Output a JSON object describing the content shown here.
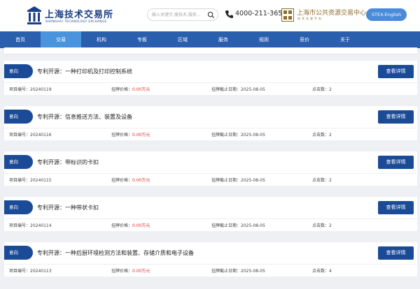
{
  "header": {
    "logo_text": "上海技术交易所",
    "logo_sub": "SHANGHAI TECHNOLOGY EXCHANGE",
    "search_placeholder": "输入关键字,搜技术,服务...",
    "phone": "4000-211-365",
    "center_name": "上海市公共资源交易中心",
    "center_sub": "技术交易平台",
    "lang_button": "STEX-English"
  },
  "nav": {
    "items": [
      "首页",
      "交易",
      "机构",
      "专板",
      "区域",
      "服务",
      "规则",
      "竞价",
      "关于"
    ],
    "active_index": 1
  },
  "cards": [
    {
      "tag": "意向",
      "title": "专利开源：一种打印机及打印控制系统",
      "button": "查看详情",
      "id_label": "项目编号：",
      "id": "20240119",
      "price_label": "挂牌价格：",
      "price": "0.00万元",
      "date_label": "挂牌截止日期：",
      "date": "2025-08-05",
      "clicks_label": "点击数：",
      "clicks": "2"
    },
    {
      "tag": "意向",
      "title": "专利开源：信息推送方法、装置及设备",
      "button": "查看详情",
      "id_label": "项目编号：",
      "id": "20240116",
      "price_label": "挂牌价格：",
      "price": "0.00万元",
      "date_label": "挂牌截止日期：",
      "date": "2025-08-05",
      "clicks_label": "点击数：",
      "clicks": "2"
    },
    {
      "tag": "意向",
      "title": "专利开源：带标识的卡扣",
      "button": "查看详情",
      "id_label": "项目编号：",
      "id": "20240115",
      "price_label": "挂牌价格：",
      "price": "0.00万元",
      "date_label": "挂牌截止日期：",
      "date": "2025-08-05",
      "clicks_label": "点击数：",
      "clicks": "2"
    },
    {
      "tag": "意向",
      "title": "专利开源：一种带状卡扣",
      "button": "查看详情",
      "id_label": "项目编号：",
      "id": "20240114",
      "price_label": "挂牌价格：",
      "price": "0.00万元",
      "date_label": "挂牌截止日期：",
      "date": "2025-08-05",
      "clicks_label": "点击数：",
      "clicks": "2"
    },
    {
      "tag": "意向",
      "title": "专利开源：一种后厨环境检测方法和装置、存储介质和电子设备",
      "button": "查看详情",
      "id_label": "项目编号：",
      "id": "20240113",
      "price_label": "挂牌价格：",
      "price": "0.00万元",
      "date_label": "挂牌截止日期：",
      "date": "2025-08-05",
      "clicks_label": "点击数：",
      "clicks": "4"
    }
  ],
  "colors": {
    "brand_dark": "#1b4b96",
    "nav": "#2a5fae",
    "nav_active": "#4a94dd",
    "price": "#d9332b",
    "lang_button": "#4a8ad8"
  }
}
